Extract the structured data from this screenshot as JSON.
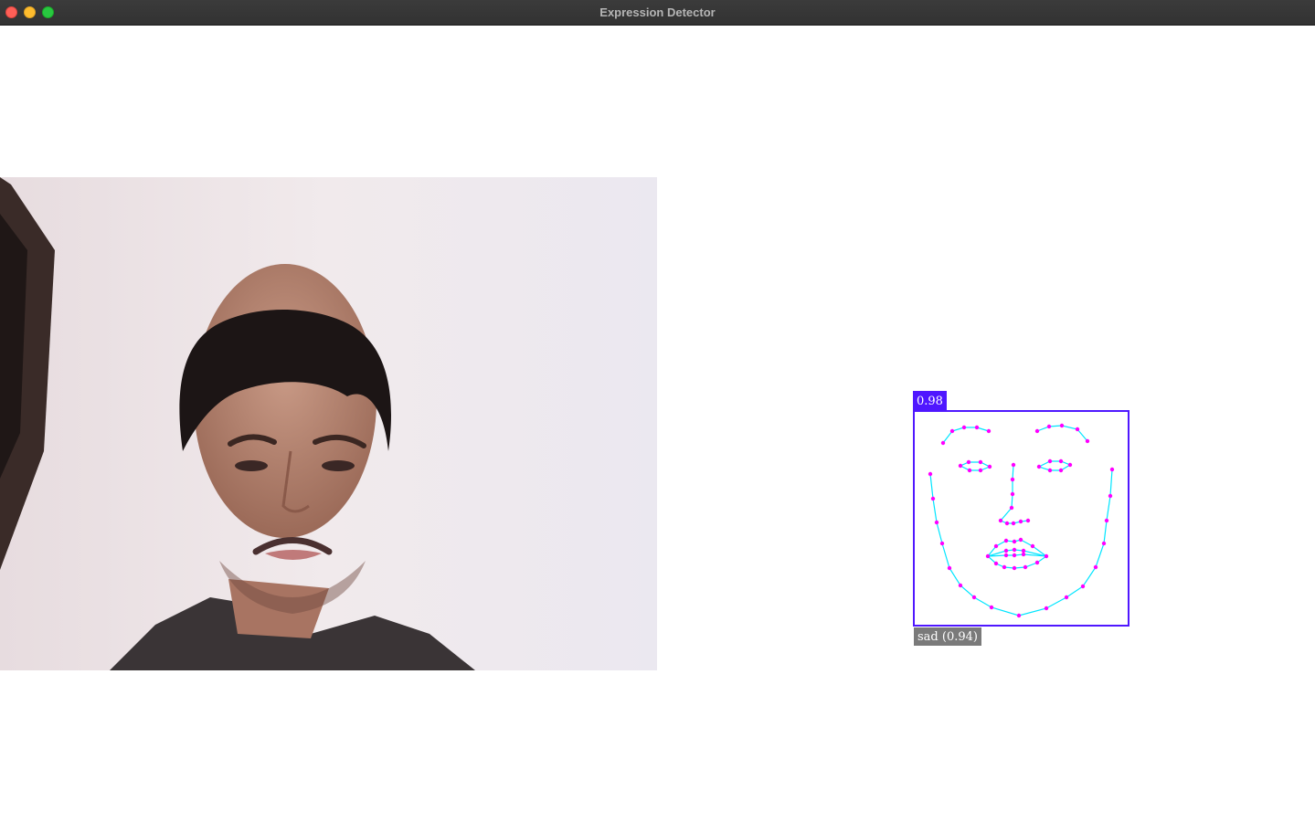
{
  "window": {
    "title": "Expression Detector"
  },
  "detection": {
    "score": "0.98",
    "expression": "sad (0.94)",
    "box_color": "#4f17ff",
    "landmark_color": "#ff00ff",
    "contour_color": "#00e5ff"
  },
  "icons": {
    "close": "close-icon",
    "minimize": "minimize-icon",
    "maximize": "maximize-icon"
  }
}
